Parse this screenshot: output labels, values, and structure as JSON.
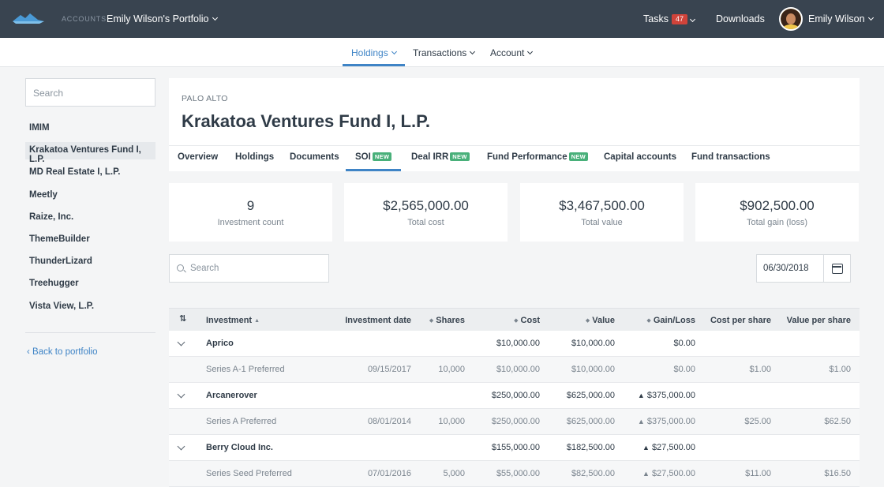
{
  "topbar": {
    "accounts_label": "ACCOUNTS",
    "portfolio_name": "Emily Wilson's Portfolio",
    "tasks_label": "Tasks",
    "tasks_count": "47",
    "downloads_label": "Downloads",
    "user_name": "Emily Wilson",
    "colors": {
      "bar": "#394450",
      "logo": "#4a9ad6",
      "badge": "#d0433a"
    }
  },
  "subnav": {
    "items": [
      {
        "label": "Holdings",
        "active": true
      },
      {
        "label": "Transactions",
        "active": false
      },
      {
        "label": "Account",
        "active": false
      }
    ]
  },
  "sidebar": {
    "search_placeholder": "Search",
    "items": [
      {
        "label": "IMIM"
      },
      {
        "label": "Krakatoa Ventures Fund I, L.P.",
        "selected": true
      },
      {
        "label": "MD Real Estate I, L.P."
      },
      {
        "label": "Meetly"
      },
      {
        "label": "Raize, Inc."
      },
      {
        "label": "ThemeBuilder"
      },
      {
        "label": "ThunderLizard"
      },
      {
        "label": "Treehugger"
      },
      {
        "label": "Vista View, L.P."
      }
    ],
    "back_link": "Back to portfolio"
  },
  "fund": {
    "location": "PALO ALTO",
    "title": "Krakatoa Ventures Fund I, L.P.",
    "tabs": [
      {
        "label": "Overview"
      },
      {
        "label": "Holdings"
      },
      {
        "label": "Documents"
      },
      {
        "label": "SOI",
        "badge": "NEW",
        "active": true
      },
      {
        "label": "Deal IRR",
        "badge": "NEW"
      },
      {
        "label": "Fund Performance",
        "badge": "NEW"
      },
      {
        "label": "Capital accounts"
      },
      {
        "label": "Fund transactions"
      }
    ]
  },
  "stats": [
    {
      "value": "9",
      "label": "Investment count"
    },
    {
      "value": "$2,565,000.00",
      "label": "Total cost"
    },
    {
      "value": "$3,467,500.00",
      "label": "Total value"
    },
    {
      "value": "$902,500.00",
      "label": "Total gain (loss)"
    }
  ],
  "filters": {
    "search_placeholder": "Search",
    "date_value": "06/30/2018"
  },
  "table": {
    "columns": {
      "investment": "Investment",
      "investment_date": "Investment date",
      "shares": "Shares",
      "cost": "Cost",
      "value": "Value",
      "gain_loss": "Gain/Loss",
      "cost_per_share": "Cost per share",
      "value_per_share": "Value per share"
    },
    "groups": [
      {
        "name": "Aprico",
        "cost": "$10,000.00",
        "value": "$10,000.00",
        "gain": "$0.00",
        "gain_up": false,
        "sub": {
          "name": "Series A-1 Preferred",
          "date": "09/15/2017",
          "shares": "10,000",
          "cost": "$10,000.00",
          "value": "$10,000.00",
          "gain": "$0.00",
          "gain_up": false,
          "cps": "$1.00",
          "vps": "$1.00"
        }
      },
      {
        "name": "Arcanerover",
        "cost": "$250,000.00",
        "value": "$625,000.00",
        "gain": "$375,000.00",
        "gain_up": true,
        "sub": {
          "name": "Series A Preferred",
          "date": "08/01/2014",
          "shares": "10,000",
          "cost": "$250,000.00",
          "value": "$625,000.00",
          "gain": "$375,000.00",
          "gain_up": true,
          "cps": "$25.00",
          "vps": "$62.50"
        }
      },
      {
        "name": "Berry Cloud Inc.",
        "cost": "$155,000.00",
        "value": "$182,500.00",
        "gain": "$27,500.00",
        "gain_up": true,
        "sub": {
          "name": "Series Seed Preferred",
          "date": "07/01/2016",
          "shares": "5,000",
          "cost": "$55,000.00",
          "value": "$82,500.00",
          "gain": "$27,500.00",
          "gain_up": true,
          "cps": "$11.00",
          "vps": "$16.50"
        }
      }
    ],
    "gain_color": "#49b07a"
  }
}
